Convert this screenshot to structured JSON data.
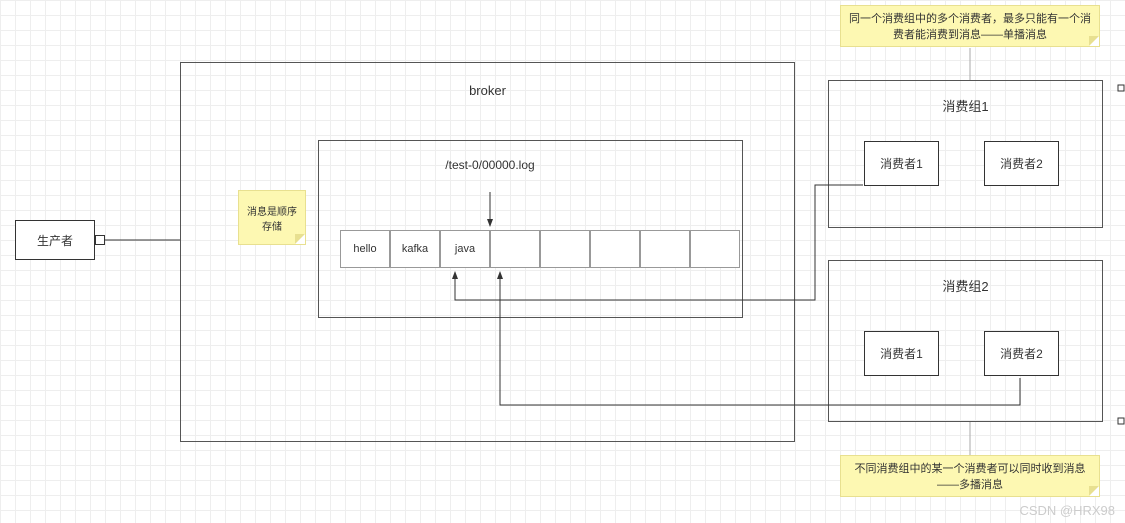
{
  "producer": {
    "label": "生产者"
  },
  "broker": {
    "title": "broker",
    "logPath": "/test-0/00000.log",
    "cells": [
      "hello",
      "kafka",
      "java",
      "",
      "",
      "",
      "",
      ""
    ]
  },
  "storageNote": {
    "text": "消息是顺序存储"
  },
  "topNote": {
    "text": "同一个消费组中的多个消费者，最多只能有一个消费者能消费到消息——单播消息"
  },
  "bottomNote": {
    "text": "不同消费组中的某一个消费者可以同时收到消息——多播消息"
  },
  "group1": {
    "title": "消费组1",
    "consumers": [
      "消费者1",
      "消费者2"
    ]
  },
  "group2": {
    "title": "消费组2",
    "consumers": [
      "消费者1",
      "消费者2"
    ]
  },
  "watermark": "CSDN @HRX98"
}
